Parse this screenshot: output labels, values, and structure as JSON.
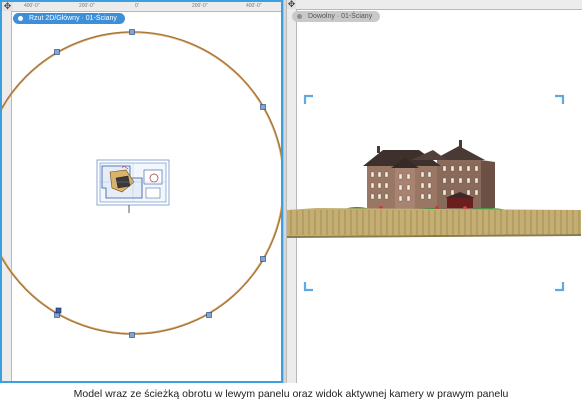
{
  "left_view": {
    "tab_label": "Rzut 2D/Główny · 01-Ściany",
    "ruler_ticks": [
      "400'-0\"",
      "200'-0\"",
      "0'",
      "200'-0\"",
      "400'-0\""
    ]
  },
  "right_view": {
    "tab_label": "Dowolny · 01-Ściany"
  },
  "caption": "Model wraz ze ścieżką obrotu w lewym panelu oraz widok aktywnej kamery w prawym panelu",
  "colors": {
    "path_circle": "#c98a3a",
    "active_border": "#3aa0e0",
    "camera_frame": "#5fa8e0",
    "fence": "#b8a46a",
    "building": "#8a6a5a"
  }
}
